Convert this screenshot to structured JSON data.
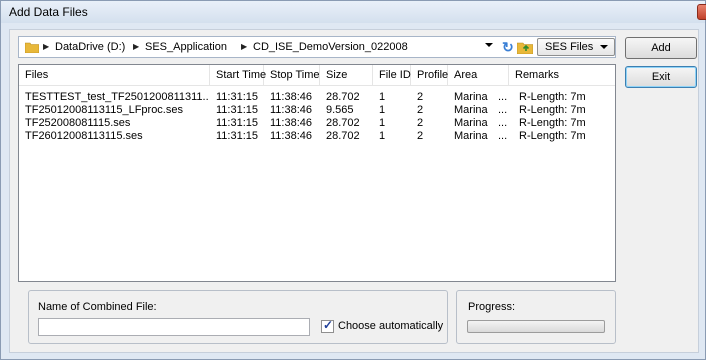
{
  "window": {
    "title": "Add Data Files"
  },
  "address": {
    "crumbs": [
      "DataDrive (D:)",
      "SES_Application",
      "CD_ISE_DemoVersion_022008"
    ],
    "filetype_selected": "SES Files"
  },
  "buttons": {
    "add": "Add",
    "exit": "Exit"
  },
  "list": {
    "columns": [
      "Files",
      "Start Time",
      "Stop Time",
      "Size",
      "File ID",
      "Profile",
      "Area",
      "Remarks"
    ],
    "rows": [
      [
        "TESTTEST_test_TF2501200811311...",
        "11:31:15",
        "11:38:46",
        "28.702",
        "1",
        "2",
        "Marina",
        "...",
        "R-Length: 7m"
      ],
      [
        "TF25012008113115_LFproc.ses",
        "11:31:15",
        "11:38:46",
        "9.565",
        "1",
        "2",
        "Marina",
        "...",
        "R-Length: 7m"
      ],
      [
        "TF252008081115.ses",
        "11:31:15",
        "11:38:46",
        "28.702",
        "1",
        "2",
        "Marina",
        "...",
        "R-Length: 7m"
      ],
      [
        "TF26012008113115.ses",
        "11:31:15",
        "11:38:46",
        "28.702",
        "1",
        "2",
        "Marina",
        "...",
        "R-Length: 7m"
      ]
    ]
  },
  "combined": {
    "label": "Name of Combined File:",
    "value": "",
    "choose_auto_label": "Choose automatically",
    "choose_auto_checked": true
  },
  "progress": {
    "label": "Progress:",
    "fraction": 0.0
  }
}
